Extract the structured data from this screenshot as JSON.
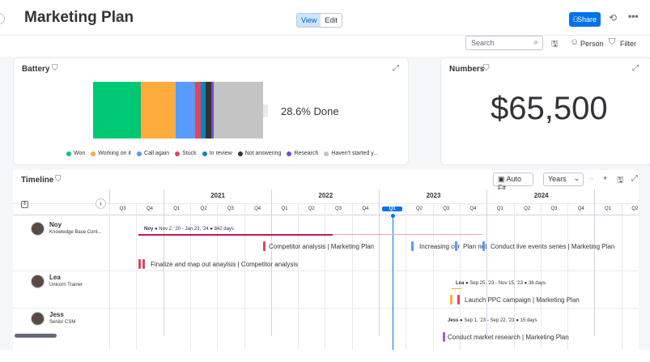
{
  "header": {
    "title": "Marketing Plan",
    "view_label": "View",
    "edit_label": "Edit",
    "share_label": "Share"
  },
  "toolbar": {
    "search_placeholder": "Search",
    "person_label": "Person",
    "filter_label": "Filter"
  },
  "battery_widget": {
    "title": "Battery",
    "done_text": "28.6% Done",
    "segments": [
      {
        "label": "Won",
        "color": "#00c875",
        "fraction": 0.283
      },
      {
        "label": "Working on it",
        "color": "#fdab3d",
        "fraction": 0.204
      },
      {
        "label": "Call again",
        "color": "#579bfc",
        "fraction": 0.113
      },
      {
        "label": "Stuck",
        "color": "#e2445c",
        "fraction": 0.033
      },
      {
        "label": "In review",
        "color": "#0086c0",
        "fraction": 0.028
      },
      {
        "label": "Not answering",
        "color": "#333333",
        "fraction": 0.033
      },
      {
        "label": "Research",
        "color": "#784bd1",
        "fraction": 0.014
      },
      {
        "label": "Haven't started y...",
        "color": "#c4c4c4",
        "fraction": 0.292
      }
    ]
  },
  "numbers_widget": {
    "title": "Numbers",
    "value": "$65,500"
  },
  "timeline": {
    "title": "Timeline",
    "auto_fit_label": "Auto Fit",
    "scale_label": "Years",
    "zoom_out": "–",
    "zoom_in": "+",
    "years": [
      "2021",
      "2022",
      "2023",
      "2024",
      "20"
    ],
    "quarters": [
      "Q3",
      "Q4",
      "Q1",
      "Q2",
      "Q3",
      "Q4",
      "Q1",
      "Q2",
      "Q3",
      "Q4",
      "Q1",
      "Q2",
      "Q3",
      "Q4",
      "Q1",
      "Q2",
      "Q3",
      "Q4",
      "Q1",
      "Q2"
    ],
    "current_quarter_index": 10,
    "people": [
      {
        "name": "Noy",
        "role": "Knowledge Base Cont...",
        "summary_name": "Noy",
        "summary_text": "Nov 2, '20 - Jan 23, '24",
        "summary_days": "842 days",
        "items": [
          {
            "text": "Competitor analysis | Marketing Plan",
            "color": "#e2445c"
          },
          {
            "text": "Increasing cor",
            "color": "#579bfc"
          },
          {
            "text": "Plan net",
            "color": "#579bfc"
          },
          {
            "text": "Conduct live events series | Marketing Plan",
            "color": "#579bfc"
          },
          {
            "text": "Finalize and map out anaylsis | Competitor analysis",
            "color": "#e2445c"
          }
        ]
      },
      {
        "name": "Lea",
        "role": "Unicorn Trainer",
        "summary_name": "Lea",
        "summary_text": "Sep 25, '23 - Nov 15, '23",
        "summary_days": "38 days",
        "items": [
          {
            "text": "Launch PPC campaign | Marketing Plan",
            "color": "#e2445c"
          }
        ]
      },
      {
        "name": "Jess",
        "role": "Senior CSM",
        "summary_name": "Jess",
        "summary_text": "Sep 1, '23 - Sep 22, '23",
        "summary_days": "15 days",
        "items": [
          {
            "text": "Conduct market research | Marketing Plan",
            "color": "#a25ddc"
          }
        ]
      }
    ]
  }
}
